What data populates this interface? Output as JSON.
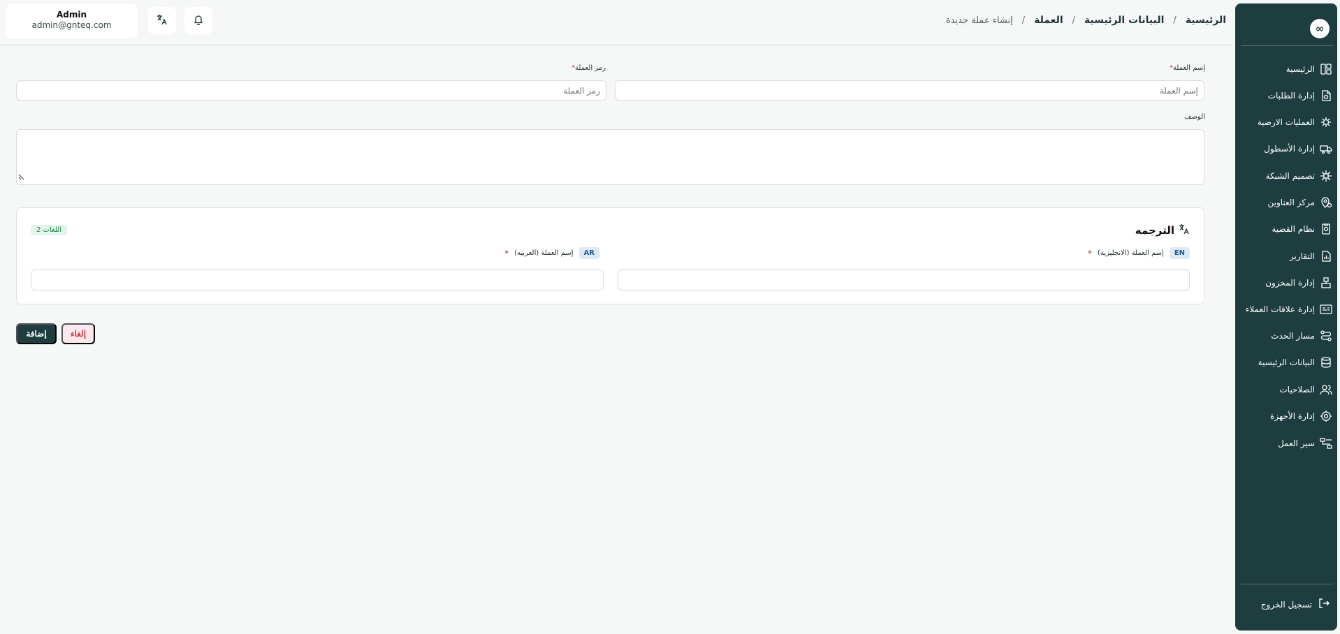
{
  "header": {
    "user_name": "Admin",
    "user_email": "admin@gnteq.com",
    "breadcrumb": [
      "الرئيسية",
      "البيانات الرئيسية",
      "العملة",
      "إنشاء عملة جديدة"
    ]
  },
  "sidebar": {
    "logo": "∞",
    "items": [
      {
        "label": "الرئيسية",
        "icon": "layout-icon"
      },
      {
        "label": "إدارة الطلبات",
        "icon": "file-sync-icon"
      },
      {
        "label": "العمليات الارضية",
        "icon": "bug-gear-icon"
      },
      {
        "label": "إدارة الأسطول",
        "icon": "truck-icon"
      },
      {
        "label": "تصميم الشبكة",
        "icon": "network-icon"
      },
      {
        "label": "مركز العناوين",
        "icon": "map-pin-icon"
      },
      {
        "label": "نظام القضية",
        "icon": "case-file-icon"
      },
      {
        "label": "التقارير",
        "icon": "report-icon"
      },
      {
        "label": "إدارة المخزون",
        "icon": "inventory-icon"
      },
      {
        "label": "إدارة علاقات العملاء",
        "icon": "crm-card-icon"
      },
      {
        "label": "مسار الحدث",
        "icon": "route-icon"
      },
      {
        "label": "البيانات الرئيسية",
        "icon": "database-icon"
      },
      {
        "label": "الصلاحيات",
        "icon": "users-icon"
      },
      {
        "label": "إدارة الأجهزة",
        "icon": "device-gear-icon"
      },
      {
        "label": "سير العمل",
        "icon": "workflow-icon"
      }
    ],
    "logout_label": "تسجيل الخروج"
  },
  "form": {
    "currency_name_label": "إسم العملة",
    "currency_name_placeholder": "إسم العملة",
    "currency_code_label": "رمز العملة",
    "currency_code_placeholder": "رمز العملة",
    "description_label": "الوصف",
    "required_mark": "*"
  },
  "translation": {
    "title": "الترجمه",
    "langs_badge": "2 اللغات",
    "en_tag": "EN",
    "en_label": "إسم العملة (الانجليزيه)",
    "ar_tag": "AR",
    "ar_label": "إسم العملة (العربيه)"
  },
  "actions": {
    "add_label": "إضافة",
    "cancel_label": "إلغاء"
  }
}
